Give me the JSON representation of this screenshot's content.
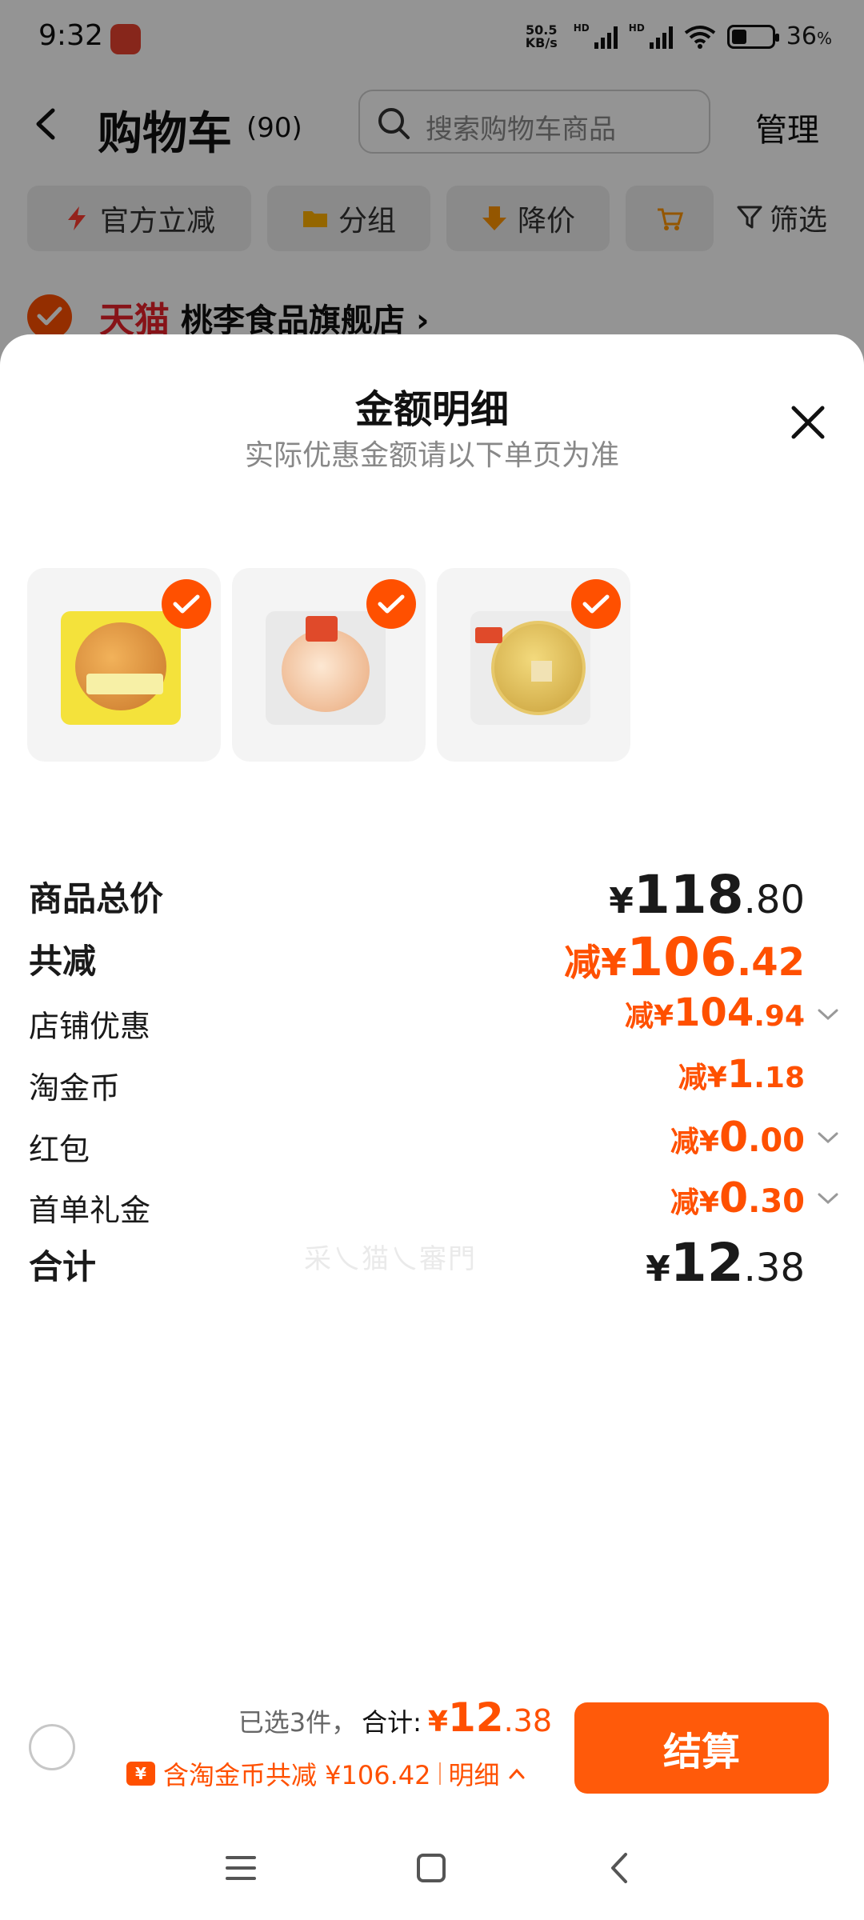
{
  "status_bar": {
    "time": "9:32",
    "net_speed_top": "50.5",
    "net_speed_bottom": "KB/s",
    "hd_label": "HD",
    "battery_pct": "36",
    "battery_unit": "%"
  },
  "header": {
    "title": "购物车",
    "count": "(90)",
    "search_placeholder": "搜索购物车商品",
    "manage_label": "管理"
  },
  "filters": {
    "items": [
      {
        "label": "官方立减",
        "icon": "lightning-icon"
      },
      {
        "label": "分组",
        "icon": "folder-icon"
      },
      {
        "label": "降价",
        "icon": "down-arrow-icon"
      },
      {
        "label": "",
        "icon": "cart-icon"
      }
    ],
    "filter_label": "筛选"
  },
  "store": {
    "brand": "天猫",
    "name": "桃李食品旗舰店",
    "arrow": "›"
  },
  "sheet": {
    "title": "金额明细",
    "subtitle": "实际优惠金额请以下单页为准",
    "watermark": "采乀猫乀審門",
    "rows": [
      {
        "label": "商品总价",
        "prefix": "",
        "symbol": "¥",
        "integer": "118",
        "decimal": ".80"
      },
      {
        "label": "共减",
        "prefix": "减",
        "symbol": "¥",
        "integer": "106",
        "decimal": ".42"
      },
      {
        "label": "店铺优惠",
        "prefix": "减",
        "symbol": "¥",
        "integer": "104",
        "decimal": ".94"
      },
      {
        "label": "淘金币",
        "prefix": "减",
        "symbol": "¥",
        "integer": "1",
        "decimal": ".18"
      },
      {
        "label": "红包",
        "prefix": "减",
        "symbol": "¥",
        "integer": "0",
        "decimal": ".00"
      },
      {
        "label": "首单礼金",
        "prefix": "减",
        "symbol": "¥",
        "integer": "0",
        "decimal": ".30"
      },
      {
        "label": "合计",
        "prefix": "",
        "symbol": "¥",
        "integer": "12",
        "decimal": ".38"
      }
    ]
  },
  "bottom_bar": {
    "selected_text": "已选3件，",
    "total_label": "合计:",
    "total_symbol": "¥",
    "total_integer": "12",
    "total_decimal": ".38",
    "coin_icon_text": "¥",
    "coin_text": "含淘金币共减 ¥106.42",
    "detail_label": "明细",
    "checkout_label": "结算"
  },
  "colors": {
    "accent": "#ff5000",
    "tmall_red": "#e8222a"
  }
}
